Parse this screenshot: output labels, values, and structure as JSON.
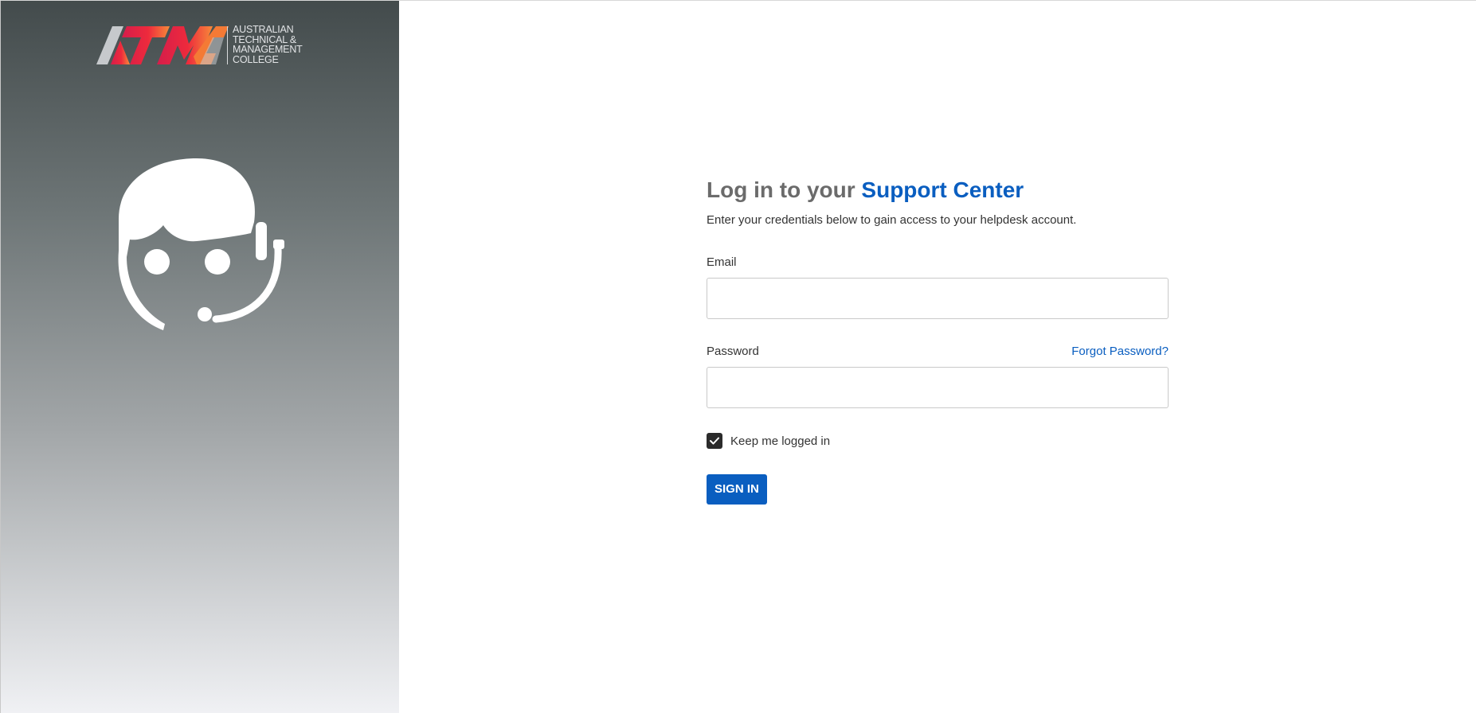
{
  "brand": {
    "logo_lines": [
      "AUSTRALIAN",
      "TECHNICAL &",
      "MANAGEMENT",
      "COLLEGE"
    ],
    "logo_icon": "atmc-logo-icon",
    "colors": {
      "accent": "#0a5ec0",
      "logo_red": "#e8213a",
      "logo_orange": "#f47a35",
      "logo_gray": "#c6c9cc"
    }
  },
  "sidebar": {
    "illustration_icon": "support-agent-headset-icon"
  },
  "login": {
    "heading_prefix": "Log in to your",
    "heading_accent": "Support Center",
    "subtitle": "Enter your credentials below to gain access to your helpdesk account.",
    "email_label": "Email",
    "email_value": "",
    "password_label": "Password",
    "password_value": "",
    "forgot_password": "Forgot Password?",
    "remember_label": "Keep me logged in",
    "remember_checked": true,
    "submit_label": "SIGN IN",
    "check_icon": "checkmark-icon"
  }
}
